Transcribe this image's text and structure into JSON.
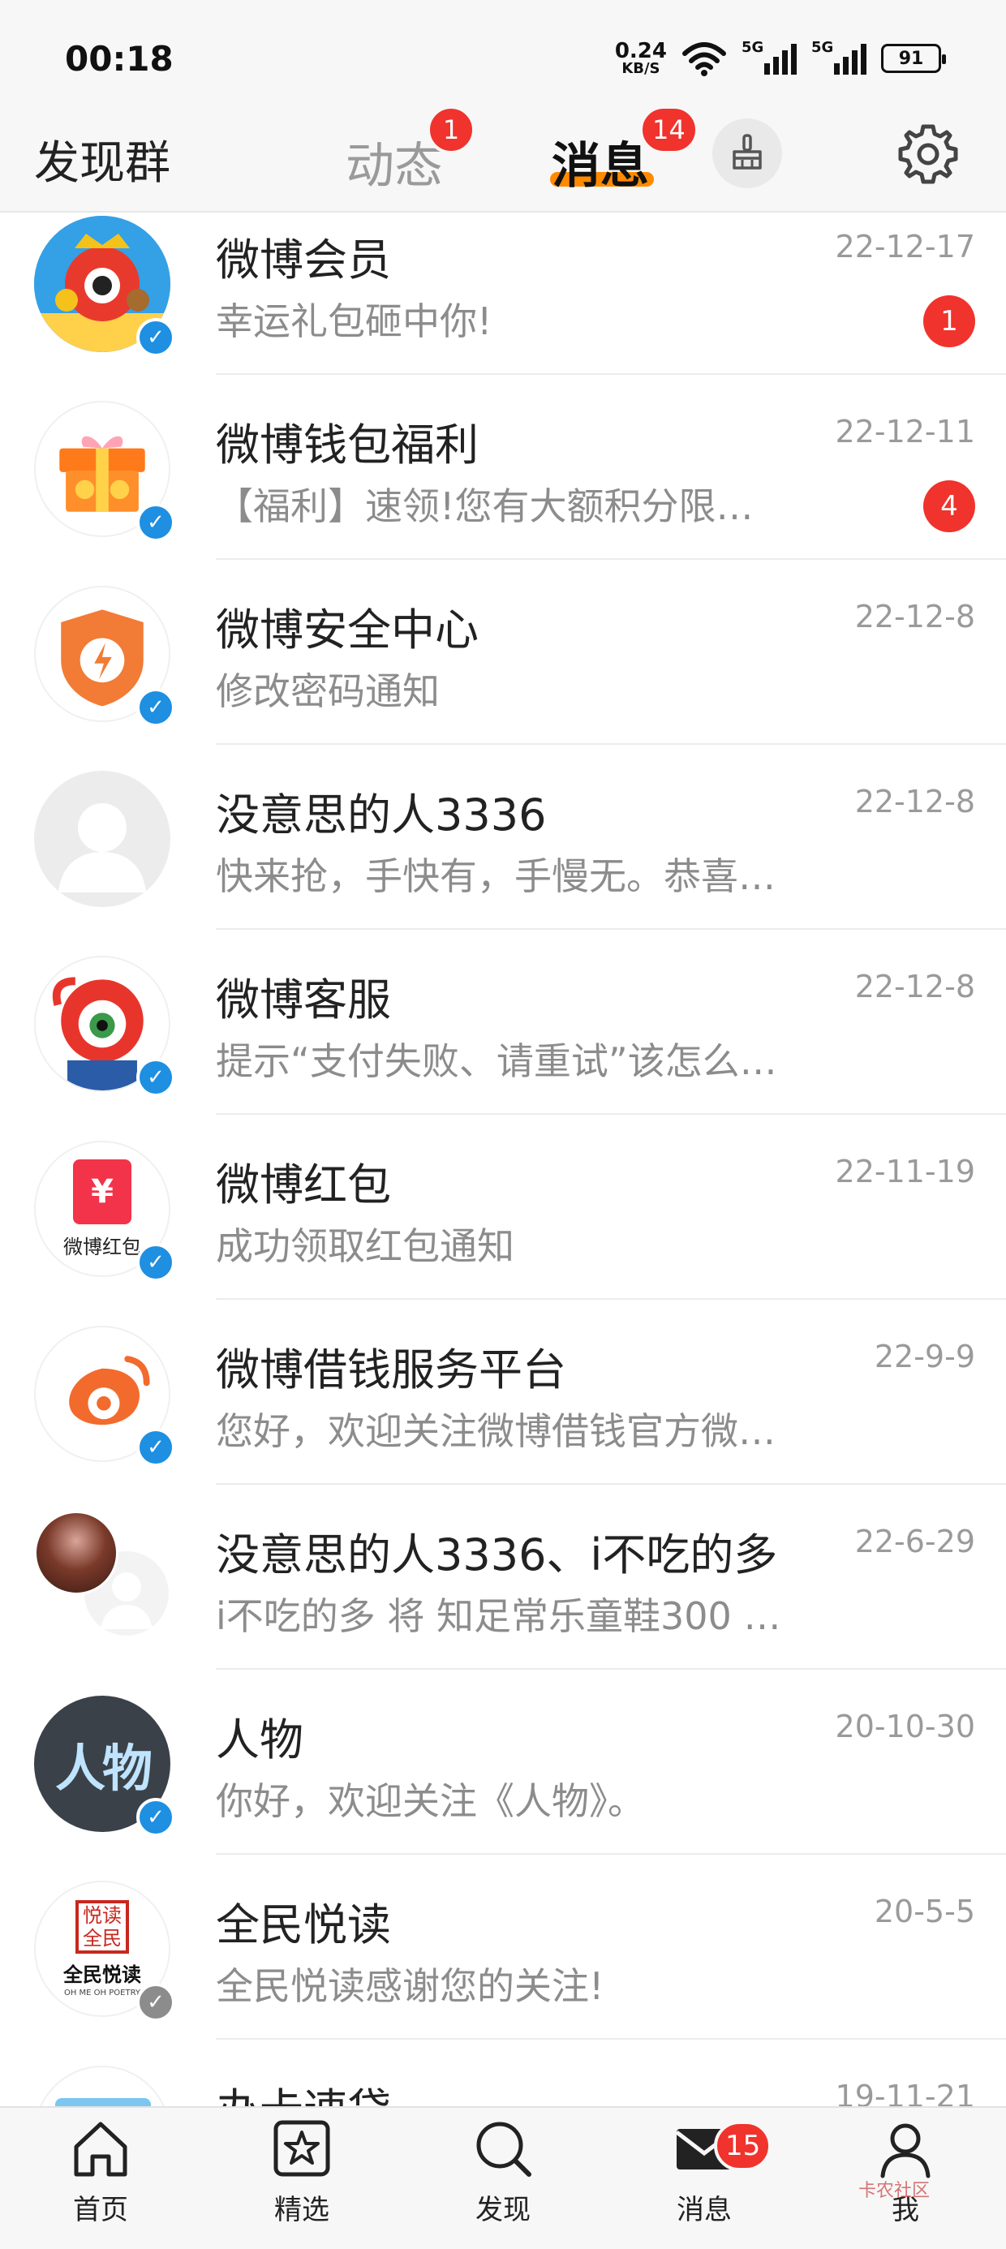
{
  "status_bar": {
    "time": "00:18",
    "net_speed_value": "0.24",
    "net_speed_unit": "KB/S",
    "signal1_label": "5G",
    "signal2_label": "5G",
    "battery": "91"
  },
  "top_nav": {
    "left_label": "发现群",
    "tabs": [
      {
        "label": "动态",
        "badge": "1"
      },
      {
        "label": "消息",
        "badge": "14",
        "selected": true
      }
    ],
    "clean_icon": "broom-icon",
    "settings_icon": "gear-icon"
  },
  "messages": [
    {
      "name": "微博会员",
      "preview": "幸运礼包砸中你!",
      "date": "22-12-17",
      "badge": "1",
      "verified": "blue"
    },
    {
      "name": "微博钱包福利",
      "preview": "【福利】速领!您有大额积分限…",
      "date": "22-12-11",
      "badge": "4",
      "verified": "blue"
    },
    {
      "name": "微博安全中心",
      "preview": "修改密码通知",
      "date": "22-12-8",
      "verified": "blue"
    },
    {
      "name": "没意思的人3336",
      "preview": "快来抢，手快有，手慢无。恭喜…",
      "date": "22-12-8"
    },
    {
      "name": "微博客服",
      "preview": "提示“支付失败、请重试”该怎么…",
      "date": "22-12-8",
      "verified": "blue"
    },
    {
      "name": "微博红包",
      "preview": "成功领取红包通知",
      "date": "22-11-19",
      "verified": "blue",
      "avatar_text": "微博红包",
      "avatar_symbol": "¥"
    },
    {
      "name": "微博借钱服务平台",
      "preview": "您好，欢迎关注微博借钱官方微…",
      "date": "22-9-9",
      "verified": "blue"
    },
    {
      "name": "没意思的人3336、i不吃的多",
      "preview": "i不吃的多 将 知足常乐童鞋300 …",
      "date": "22-6-29"
    },
    {
      "name": "人物",
      "preview": "你好，欢迎关注《人物》。",
      "date": "20-10-30",
      "verified": "blue",
      "avatar_text": "人物"
    },
    {
      "name": "全民悦读",
      "preview": "全民悦读感谢您的关注!",
      "date": "20-5-5",
      "verified": "gray",
      "avatar_text": "全民悦读",
      "avatar_seal": "悦读全民",
      "avatar_sub": "OH ME OH POETRY"
    },
    {
      "name": "办卡速贷",
      "preview": "",
      "date": "19-11-21"
    }
  ],
  "bottom_tabs": [
    {
      "label": "首页",
      "icon": "home-icon"
    },
    {
      "label": "精选",
      "icon": "star-icon"
    },
    {
      "label": "发现",
      "icon": "search-icon"
    },
    {
      "label": "消息",
      "icon": "mail-icon",
      "badge": "15"
    },
    {
      "label": "我",
      "icon": "profile-icon"
    }
  ],
  "watermark": "卡农社区"
}
